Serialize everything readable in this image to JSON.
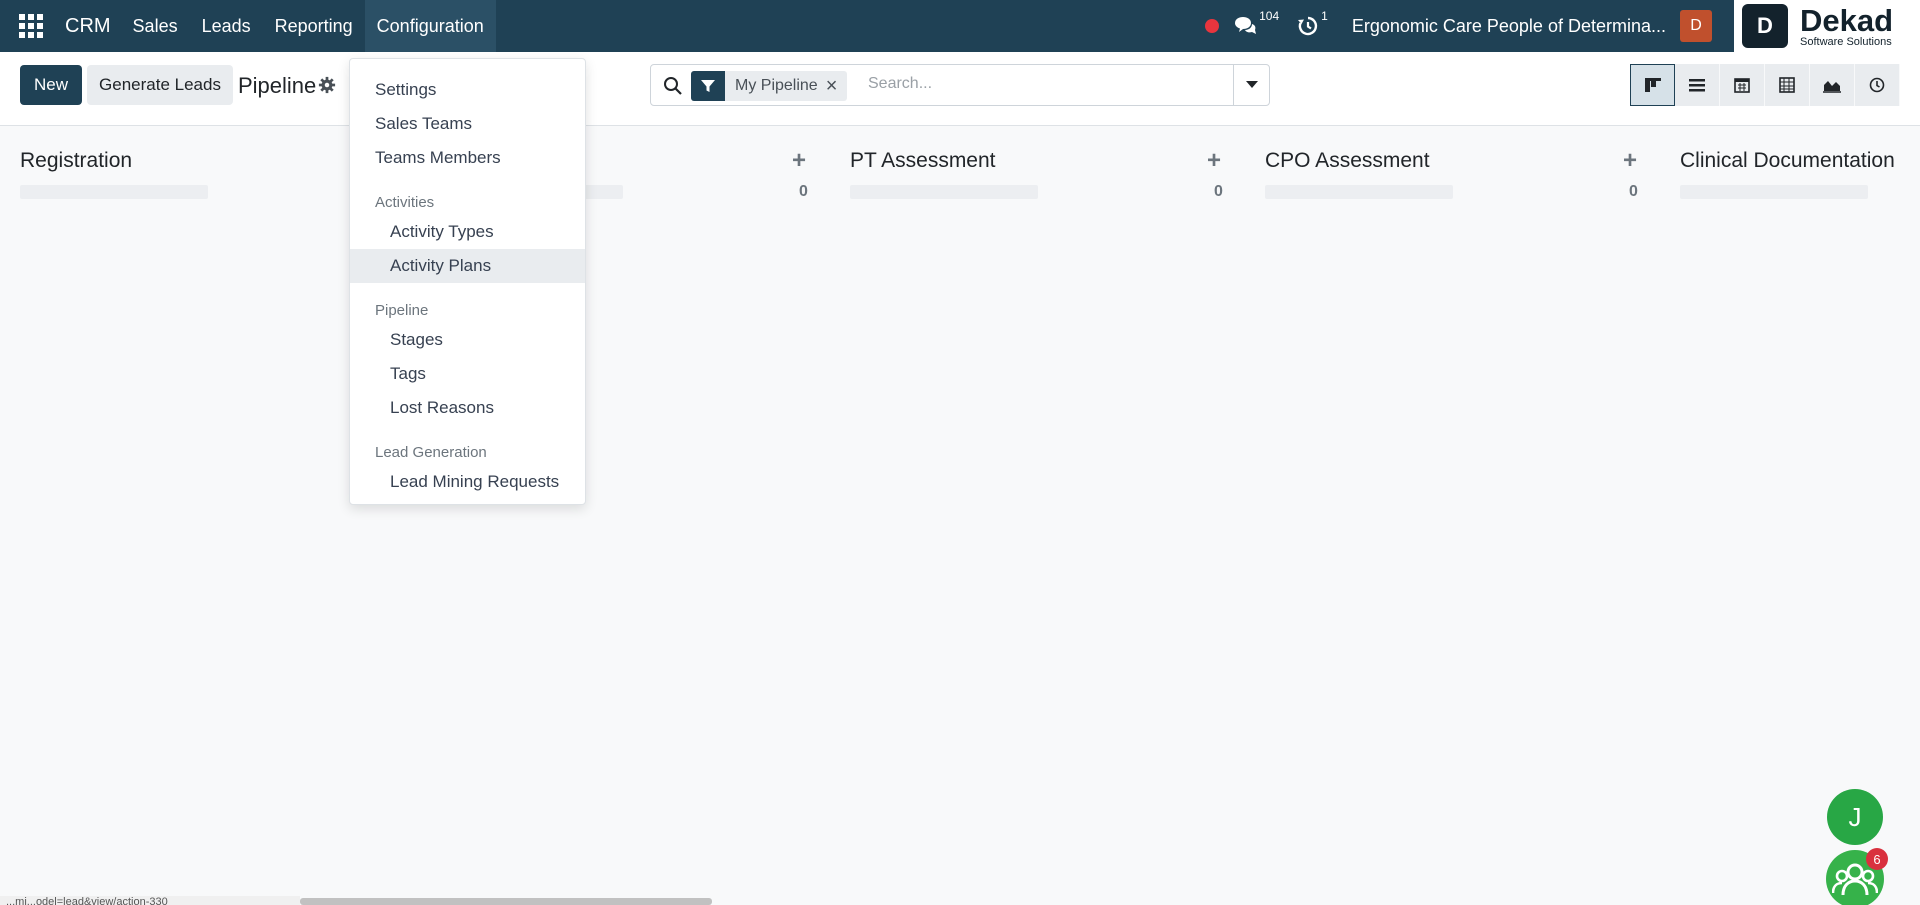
{
  "navbar": {
    "app_name": "CRM",
    "menu": [
      "Sales",
      "Leads",
      "Reporting",
      "Configuration"
    ],
    "chat_count": "104",
    "activity_count": "1",
    "company": "Ergonomic Care People of Determina...",
    "user_initial": "D",
    "logo": {
      "name": "Dekad",
      "tagline": "Software Solutions",
      "mark": "D"
    }
  },
  "control": {
    "new_label": "New",
    "generate_label": "Generate Leads",
    "title": "Pipeline"
  },
  "search": {
    "facet": "My Pipeline",
    "placeholder": "Search..."
  },
  "views": [
    "kanban-view",
    "list-view",
    "calendar-view",
    "pivot-view",
    "graph-view",
    "activity-view"
  ],
  "columns": [
    {
      "title": "Registration",
      "count": ""
    },
    {
      "title": "",
      "count": "0"
    },
    {
      "title": "PT Assessment",
      "count": "0"
    },
    {
      "title": "CPO Assessment",
      "count": "0"
    },
    {
      "title": "Clinical Documentation",
      "count": ""
    }
  ],
  "dropdown": {
    "settings": "Settings",
    "sales_teams": "Sales Teams",
    "teams_members": "Teams Members",
    "activities_header": "Activities",
    "activity_types": "Activity Types",
    "activity_plans": "Activity Plans",
    "pipeline_header": "Pipeline",
    "stages": "Stages",
    "tags": "Tags",
    "lost_reasons": "Lost Reasons",
    "lead_gen_header": "Lead Generation",
    "lead_mining": "Lead Mining Requests"
  },
  "fab": {
    "initial": "J",
    "badge": "6"
  },
  "status_url": "...mi...odel=lead&view/action-330",
  "colors": {
    "navbar": "#1f4155",
    "accent": "#1f4155",
    "green": "#28a745",
    "badge": "#d9303e"
  }
}
